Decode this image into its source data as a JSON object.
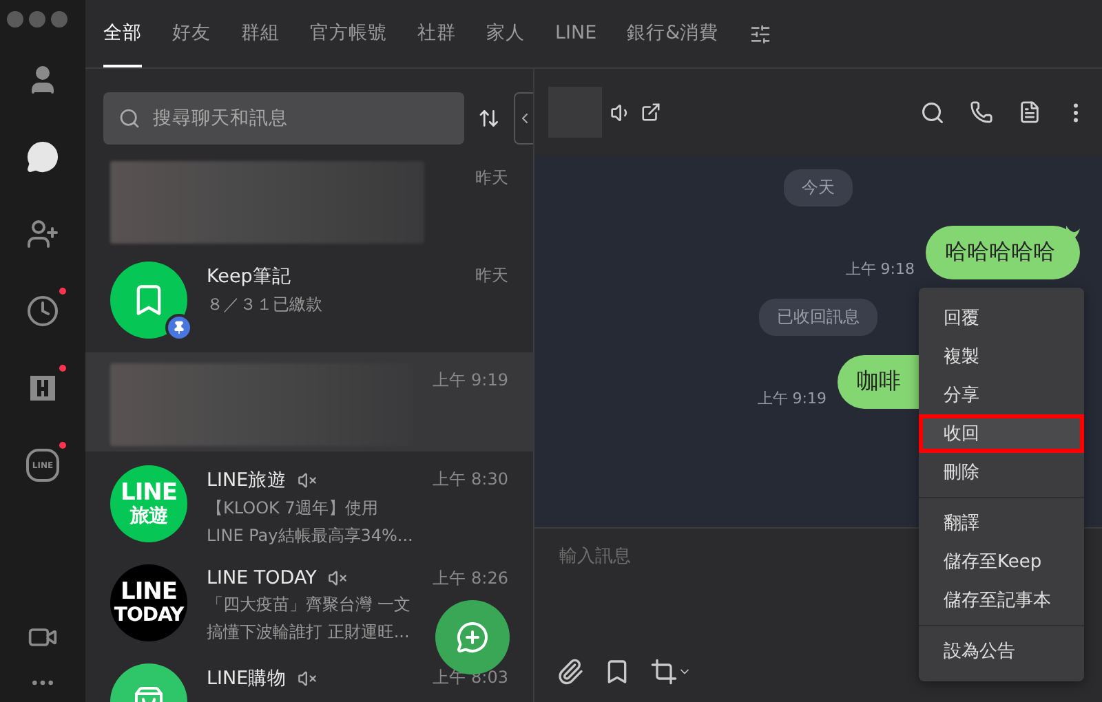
{
  "rail": {
    "items": [
      {
        "kind": "friends",
        "selected": false,
        "badge": false
      },
      {
        "kind": "chats",
        "selected": true,
        "badge": false
      },
      {
        "kind": "add-friend",
        "selected": false,
        "badge": false
      },
      {
        "kind": "timeline",
        "selected": false,
        "badge": true
      },
      {
        "kind": "square",
        "selected": false,
        "badge": true
      },
      {
        "kind": "line",
        "selected": false,
        "badge": true,
        "label": "LINE"
      }
    ],
    "bottom": [
      {
        "kind": "video"
      },
      {
        "kind": "more"
      }
    ]
  },
  "tabs": [
    {
      "label": "全部",
      "selected": true
    },
    {
      "label": "好友",
      "selected": false
    },
    {
      "label": "群組",
      "selected": false
    },
    {
      "label": "官方帳號",
      "selected": false
    },
    {
      "label": "社群",
      "selected": false
    },
    {
      "label": "家人",
      "selected": false
    },
    {
      "label": "LINE",
      "selected": false
    },
    {
      "label": "銀行&消費",
      "selected": false
    }
  ],
  "search": {
    "placeholder": "搜尋聊天和訊息"
  },
  "chats": [
    {
      "kind": "blurred",
      "time": "昨天",
      "selected": false
    },
    {
      "kind": "keep",
      "color": "#06c755",
      "name": "Keep筆記",
      "preview": [
        "８／３１已繳款"
      ],
      "time": "昨天",
      "pinned": true,
      "muted": false,
      "selected": false
    },
    {
      "kind": "blurred",
      "time": "上午 9:19",
      "selected": true
    },
    {
      "kind": "logo",
      "color": "#06c755",
      "avatar_lines": [
        "LINE",
        "旅遊"
      ],
      "name": "LINE旅遊",
      "preview": [
        "【KLOOK 7週年】使用",
        "LINE Pay結帳最高享34%..."
      ],
      "time": "上午 8:30",
      "muted": true,
      "selected": false
    },
    {
      "kind": "logo",
      "color": "#000000",
      "avatar_lines": [
        "LINE",
        "TODAY"
      ],
      "name": "LINE TODAY",
      "preview": [
        "「四大疫苗」齊聚台灣 一文",
        "搞懂下波輪誰打 正財運旺..."
      ],
      "time": "上午 8:26",
      "muted": true,
      "selected": false
    },
    {
      "kind": "shop",
      "color": "#2fc66a",
      "name": "LINE購物",
      "time": "上午 8:03",
      "muted": true,
      "selected": false
    }
  ],
  "chat": {
    "messages": [
      {
        "kind": "date",
        "text": "今天"
      },
      {
        "kind": "sent",
        "text": "哈哈哈哈哈",
        "time": "上午 9:18",
        "menu_open": false
      },
      {
        "kind": "system",
        "text": "已收回訊息"
      },
      {
        "kind": "sent",
        "text": "咖啡",
        "time": "上午 9:19",
        "menu_open": true
      }
    ],
    "input": {
      "placeholder": "輸入訊息"
    }
  },
  "context_menu": [
    [
      {
        "label": "回覆",
        "selected": false
      },
      {
        "label": "複製",
        "selected": false
      },
      {
        "label": "分享",
        "selected": false
      },
      {
        "label": "收回",
        "selected": true
      },
      {
        "label": "刪除",
        "selected": false
      }
    ],
    [
      {
        "label": "翻譯",
        "selected": false
      },
      {
        "label": "儲存至Keep",
        "selected": false
      },
      {
        "label": "儲存至記事本",
        "selected": false
      }
    ],
    [
      {
        "label": "設為公告",
        "selected": false
      }
    ]
  ]
}
